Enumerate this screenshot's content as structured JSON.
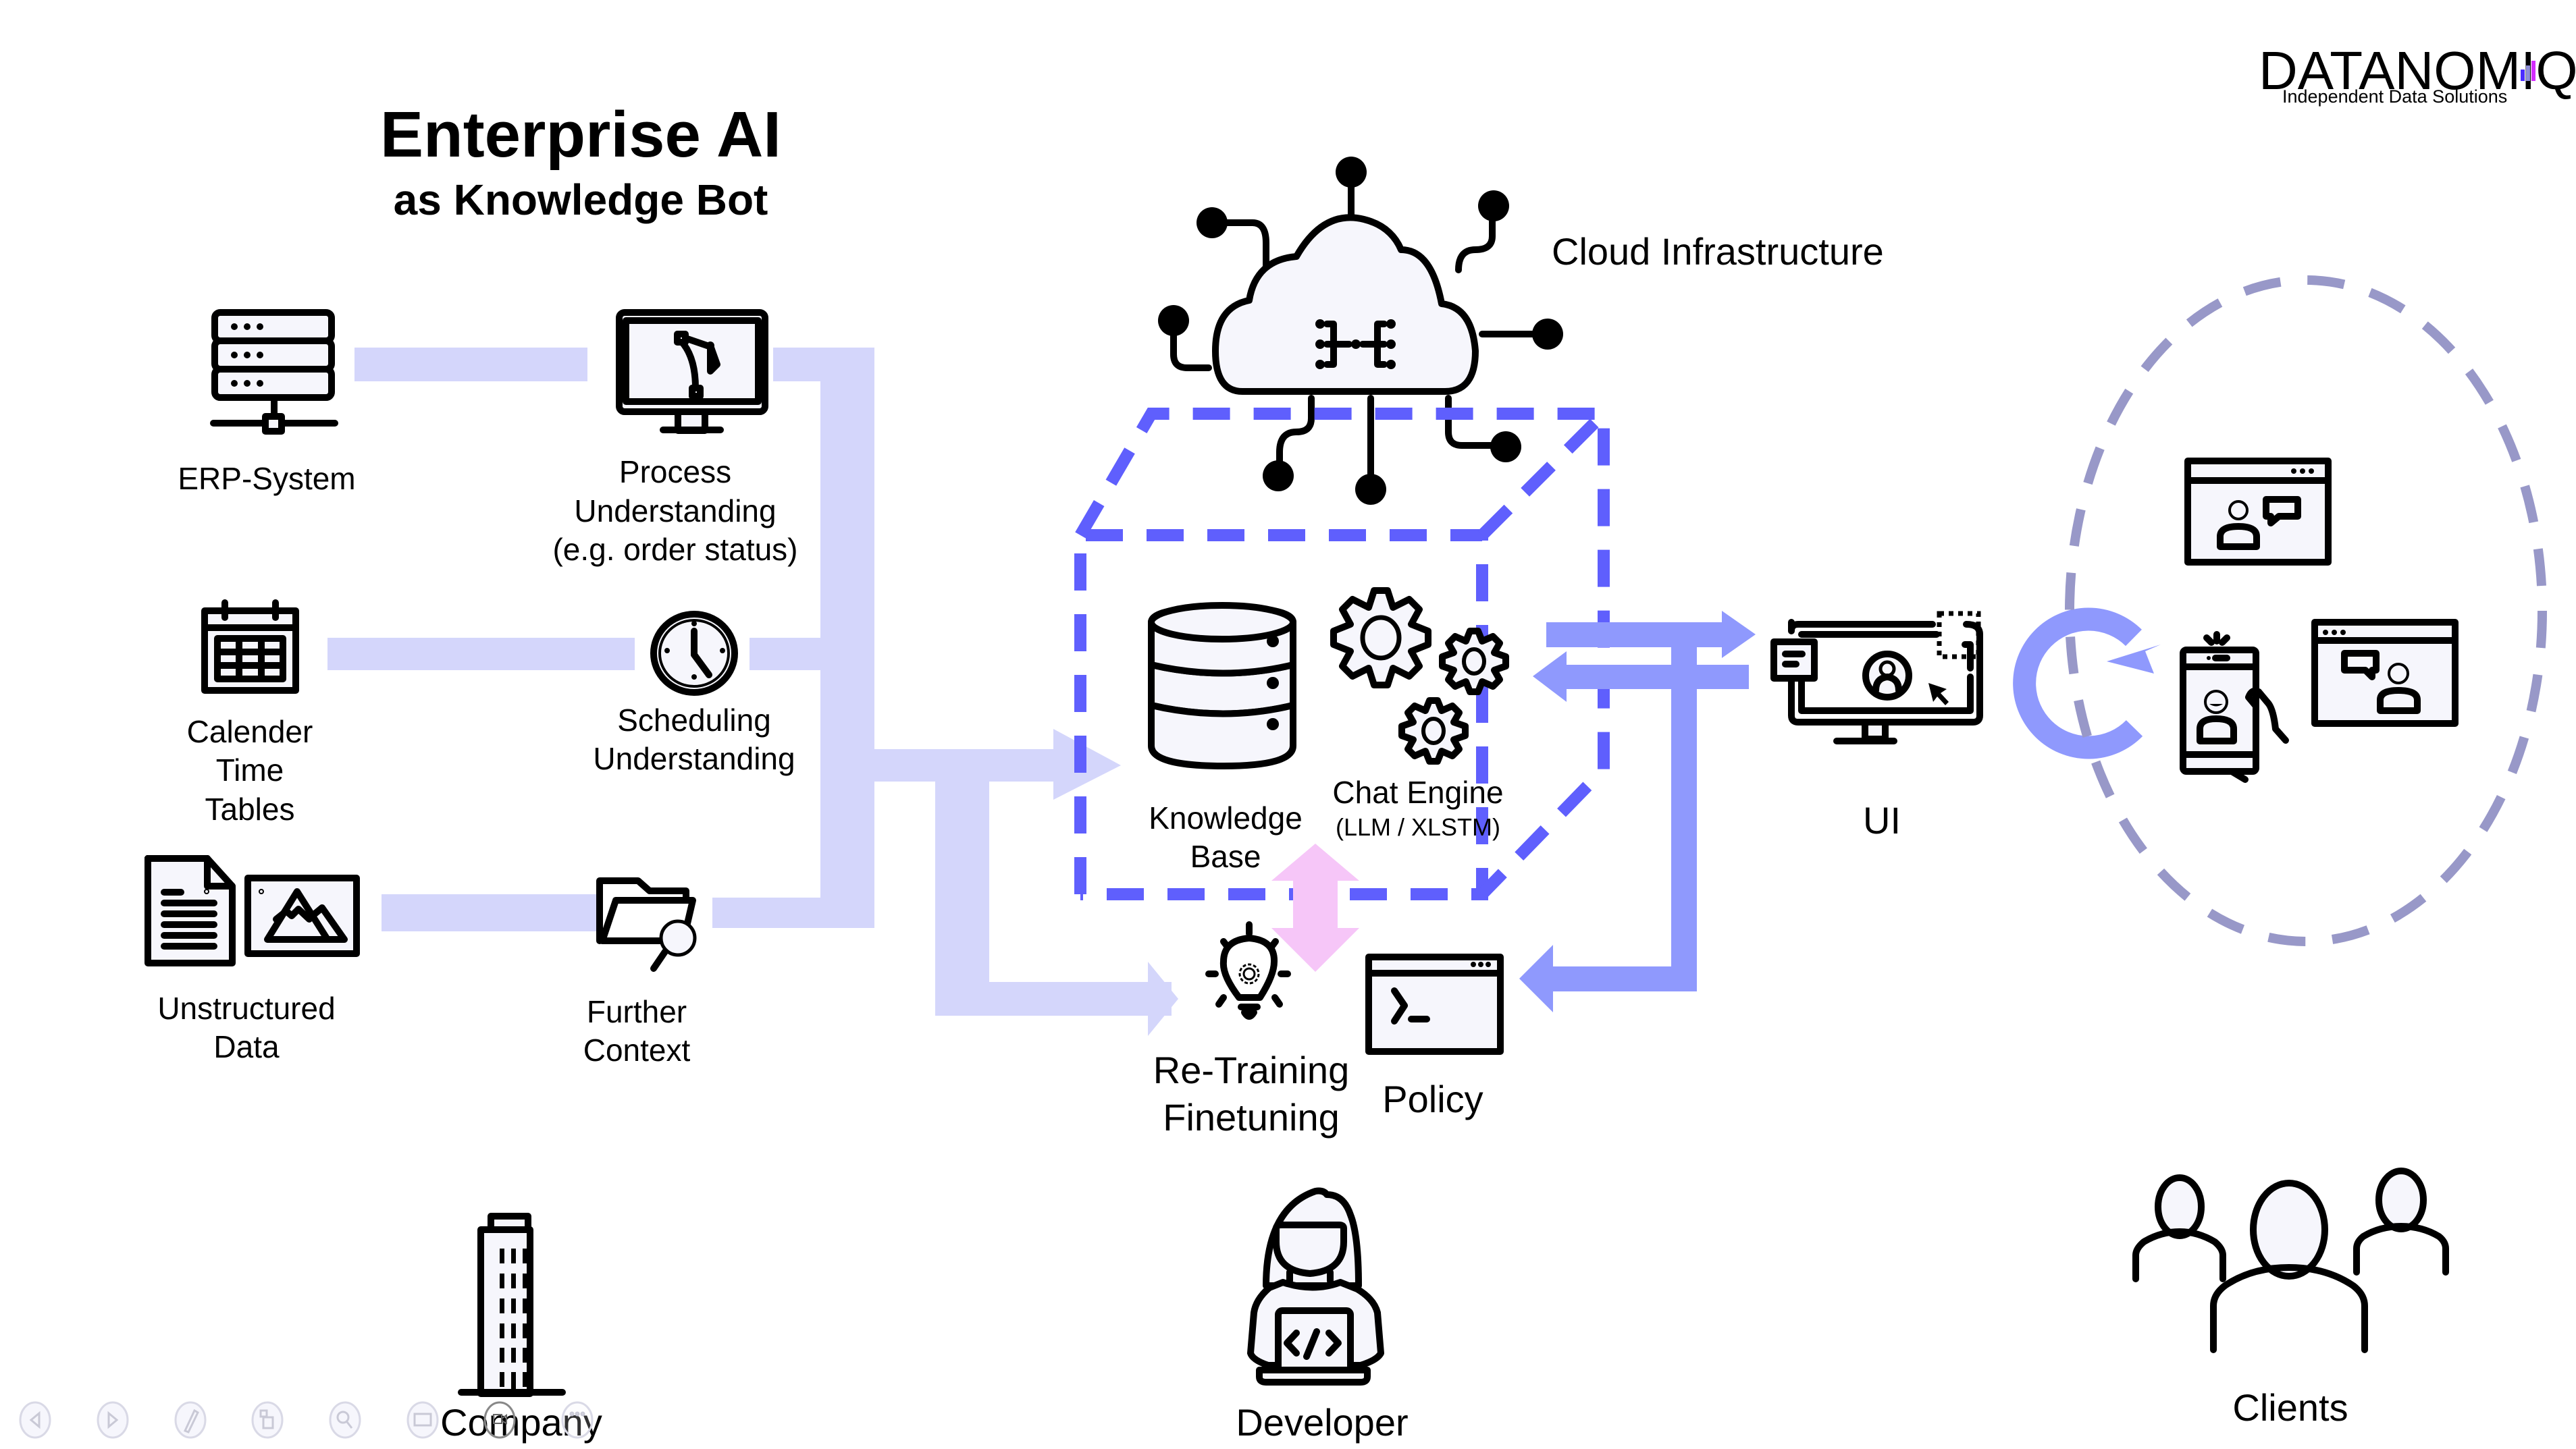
{
  "title": {
    "main": "Enterprise AI",
    "sub": "as Knowledge Bot"
  },
  "logo": {
    "name": "DATANOMIQ",
    "tagline": "Independent Data Solutions",
    "bar_colors": [
      "#4b2cff",
      "#8f8fd8",
      "#d42cff"
    ]
  },
  "sources": [
    {
      "id": "erp",
      "label_lines": [
        "ERP-System"
      ],
      "icon": "server-icon"
    },
    {
      "id": "calendar",
      "label_lines": [
        "Calender",
        "Time",
        "Tables"
      ],
      "icon": "calendar-icon"
    },
    {
      "id": "unstructured",
      "label_lines": [
        "Unstructured",
        "Data"
      ],
      "icon": "document-image-icon"
    }
  ],
  "understanding": [
    {
      "id": "process",
      "label_lines": [
        "Process",
        "Understanding",
        "(e.g. order status)"
      ],
      "icon": "monitor-bezier-icon"
    },
    {
      "id": "scheduling",
      "label_lines": [
        "Scheduling",
        "Understanding"
      ],
      "icon": "clock-icon"
    },
    {
      "id": "context",
      "label_lines": [
        "Further",
        "Context"
      ],
      "icon": "folder-search-icon"
    }
  ],
  "cloud": {
    "label": "Cloud Infrastructure",
    "icon": "cloud-network-icon"
  },
  "core": {
    "knowledge_base": {
      "label_lines": [
        "Knowledge",
        "Base"
      ],
      "icon": "database-icon"
    },
    "chat_engine": {
      "label": "Chat Engine",
      "sublabel": "(LLM / XLSTM)",
      "icon": "gears-icon"
    }
  },
  "retraining": {
    "label_lines": [
      "Re-Training",
      "Finetuning"
    ],
    "icon": "lightbulb-gear-icon"
  },
  "policy": {
    "label": "Policy",
    "icon": "terminal-window-icon"
  },
  "ui": {
    "label": "UI",
    "icon": "monitor-user-icon"
  },
  "client_channels": [
    {
      "icon": "browser-chat-icon"
    },
    {
      "icon": "smartphone-video-icon"
    },
    {
      "icon": "browser-chat-icon"
    }
  ],
  "actors": [
    {
      "id": "company",
      "label": "Company",
      "icon": "building-icon"
    },
    {
      "id": "developer",
      "label": "Developer",
      "icon": "developer-icon"
    },
    {
      "id": "clients",
      "label": "Clients",
      "icon": "users-group-icon"
    }
  ],
  "colors": {
    "flow_light": "#d4d6fb",
    "flow_dark": "#8f99fd",
    "dashed_box": "#5f5ffd",
    "client_ellipse": "#9898c8",
    "training_arrow": "#f6c6f8"
  },
  "presentation_controls": [
    {
      "icon": "previous-icon"
    },
    {
      "icon": "next-icon"
    },
    {
      "icon": "pen-icon"
    },
    {
      "icon": "slides-icon"
    },
    {
      "icon": "zoom-icon"
    },
    {
      "icon": "subtitles-icon"
    },
    {
      "icon": "camera-icon"
    },
    {
      "icon": "more-icon"
    }
  ]
}
